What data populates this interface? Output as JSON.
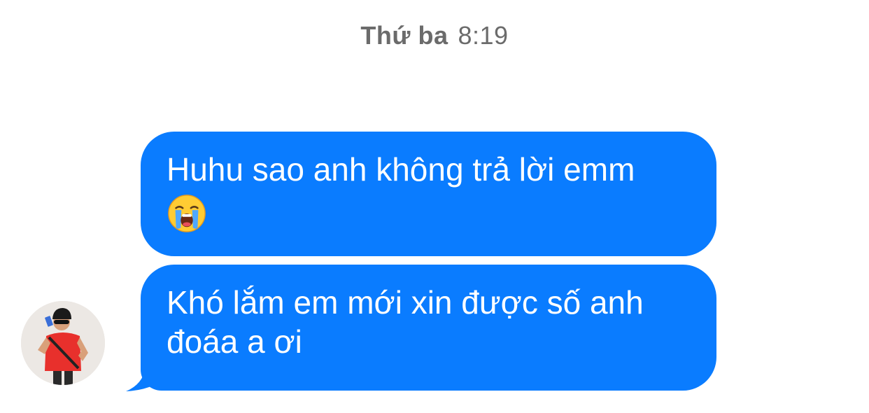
{
  "header": {
    "day": "Thứ ba",
    "time": "8:19"
  },
  "messages": [
    {
      "text": "Huhu sao anh không trả lời emm",
      "emoji": "loudly-crying-face"
    },
    {
      "line1": "Khó lắm em mới xin được số anh",
      "line2": "đoáa a ơi"
    }
  ],
  "colors": {
    "bubble": "#0a7cff",
    "bubble_text": "#ffffff",
    "timestamp": "#6b6b6b",
    "background": "#ffffff"
  }
}
